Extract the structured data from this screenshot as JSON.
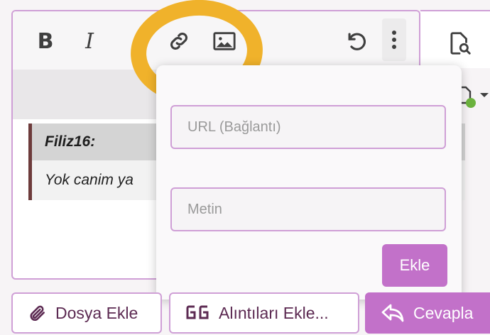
{
  "toolbar": {
    "bold_label": "B",
    "italic_label": "I",
    "icons": [
      "bold-icon",
      "italic-icon",
      "link-icon",
      "image-icon",
      "undo-icon",
      "more-vertical-icon",
      "preview-icon",
      "save-draft-icon"
    ]
  },
  "quote": {
    "author": "Filiz16:",
    "text": "Yok canim ya"
  },
  "link_popup": {
    "url_placeholder": "URL (Bağlantı)",
    "text_placeholder": "Metin",
    "add_label": "Ekle"
  },
  "actions": {
    "attach_label": "Dosya Ekle",
    "quotes_label": "Alıntıları Ekle...",
    "reply_label": "Cevapla"
  },
  "colors": {
    "accent": "#c271c9",
    "border": "#cf9fd6",
    "highlight": "#f0b22b",
    "status": "#6cb33e"
  }
}
